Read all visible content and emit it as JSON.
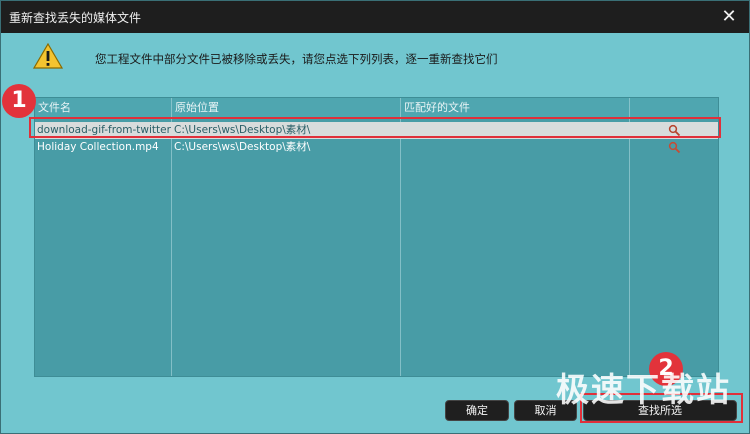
{
  "window": {
    "title": "重新查找丢失的媒体文件",
    "close_symbol": "✕"
  },
  "message": "您工程文件中部分文件已被移除或丢失，请您点选下列列表，逐一重新查找它们",
  "table": {
    "columns": [
      "文件名",
      "原始位置",
      "匹配好的文件",
      ""
    ],
    "rows": [
      {
        "name": "download-gif-from-twitter.gif",
        "location": "C:\\Users\\ws\\Desktop\\素材\\",
        "matched": "",
        "selected": true
      },
      {
        "name": "Holiday Collection.mp4",
        "location": "C:\\Users\\ws\\Desktop\\素材\\",
        "matched": "",
        "selected": false
      }
    ]
  },
  "buttons": {
    "ok": "确定",
    "cancel": "取消",
    "find_all": "查找所选"
  },
  "badges": {
    "step1": "1",
    "step2": "2"
  },
  "watermark": "极速下载站",
  "colors": {
    "accent_red": "#e0303a",
    "window_bg": "#71c6cf",
    "table_bg": "#489ca6"
  },
  "icons": {
    "warning": "warning-icon",
    "search": "search-icon",
    "close": "close-icon"
  }
}
